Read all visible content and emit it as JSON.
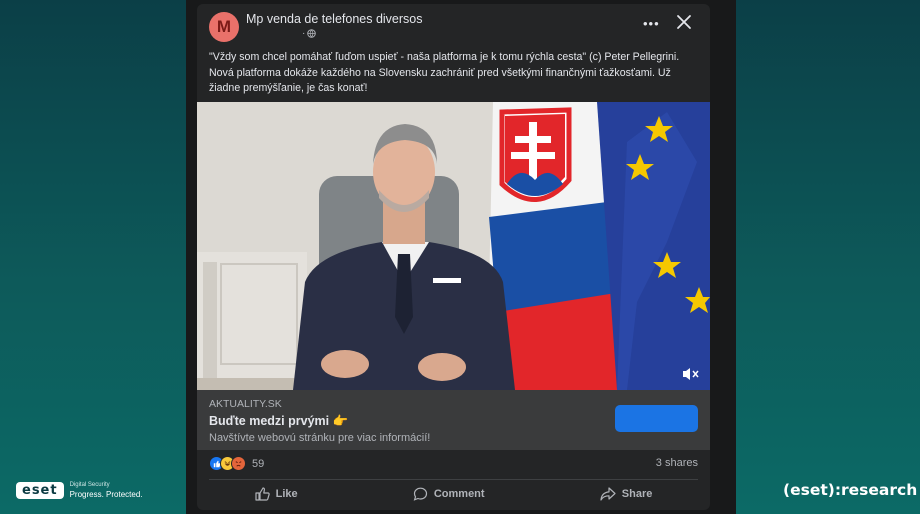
{
  "post": {
    "avatar_letter": "M",
    "page_name": "Mp venda de telefones diversos",
    "meta_separator": "·",
    "text_line1": "\"Vždy som chcel pomáhať ľuďom uspieť - naša platforma je k tomu rýchla cesta\" (c) Peter Pellegrini.",
    "text_line2": "Nová platforma dokáže každého na Slovensku zachrániť pred všetkými finančnými ťažkosťami. Už",
    "text_line3": "žiadne premýšľanie, je čas konať!"
  },
  "link_preview": {
    "domain": "AKTUALITY.SK",
    "title": "Buďte medzi prvými 👉",
    "description": "Navštívte webovú stránku pre viac informácií!",
    "button_label": ""
  },
  "engagement": {
    "reaction_count": "59",
    "shares": "3 shares"
  },
  "actions": {
    "like": "Like",
    "comment": "Comment",
    "share": "Share"
  },
  "branding": {
    "eset_logo": "eset",
    "eset_tagline_small": "Digital Security",
    "eset_tagline": "Progress. Protected.",
    "research": "(eset):research"
  },
  "colors": {
    "card_bg": "#242526",
    "link_box_bg": "#3a3b3c",
    "cta_blue": "#1b74e4",
    "avatar": "#e9716a",
    "background_teal": "#0d5a5a"
  },
  "icons": [
    "more-icon",
    "close-icon",
    "globe-icon",
    "mute-icon",
    "like-icon",
    "comment-icon",
    "share-icon"
  ]
}
